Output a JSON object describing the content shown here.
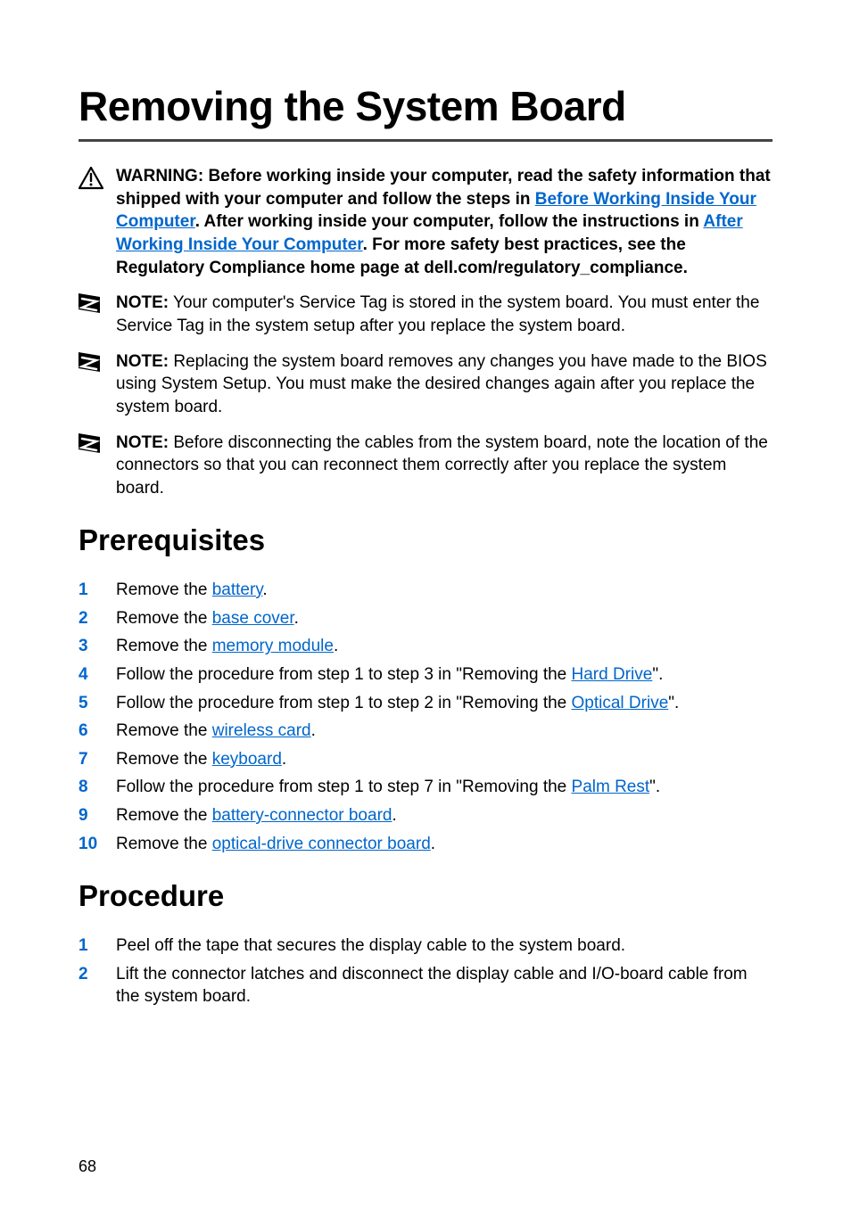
{
  "title": "Removing the System Board",
  "warning": {
    "lead": "WARNING: ",
    "t1": "Before working inside your computer, read the safety information that shipped with your computer and follow the steps in ",
    "l1": "Before Working Inside Your Computer",
    "t2": ". After working inside your computer, follow the instructions in ",
    "l2": "After Working Inside Your Computer",
    "t3": ". For more safety best practices, see the Regulatory Compliance home page at dell.com/regulatory_compliance."
  },
  "notes": [
    {
      "lead": "NOTE:",
      "text": " Your computer's Service Tag is stored in the system board. You must enter the Service Tag in the system setup after you replace the system board."
    },
    {
      "lead": "NOTE:",
      "text": " Replacing the system board removes any changes you have made to the BIOS using System Setup. You must make the desired changes again after you replace the system board."
    },
    {
      "lead": "NOTE:",
      "text": " Before disconnecting the cables from the system board, note the location of the connectors so that you can reconnect them correctly after you replace the system board."
    }
  ],
  "prereq_heading": "Prerequisites",
  "prereq": [
    {
      "pre": "Remove the ",
      "link": "battery",
      "post": "."
    },
    {
      "pre": "Remove the ",
      "link": "base cover",
      "post": "."
    },
    {
      "pre": "Remove the ",
      "link": "memory module",
      "post": "."
    },
    {
      "pre": "Follow the procedure from step 1 to step 3 in \"Removing the ",
      "link": "Hard Drive",
      "post": "\"."
    },
    {
      "pre": "Follow the procedure from step 1 to step 2 in \"Removing the ",
      "link": "Optical Drive",
      "post": "\"."
    },
    {
      "pre": "Remove the ",
      "link": "wireless card",
      "post": "."
    },
    {
      "pre": "Remove the ",
      "link": "keyboard",
      "post": "."
    },
    {
      "pre": "Follow the procedure from step 1 to step 7 in \"Removing the ",
      "link": "Palm Rest",
      "post": "\"."
    },
    {
      "pre": "Remove the ",
      "link": "battery-connector board",
      "post": "."
    },
    {
      "pre": "Remove the ",
      "link": "optical-drive connector board",
      "post": "."
    }
  ],
  "proc_heading": "Procedure",
  "proc": [
    {
      "text": "Peel off the tape that secures the display cable to the system board."
    },
    {
      "text": "Lift the connector latches and disconnect the display cable and I/O-board cable from the system board."
    }
  ],
  "page": "68"
}
